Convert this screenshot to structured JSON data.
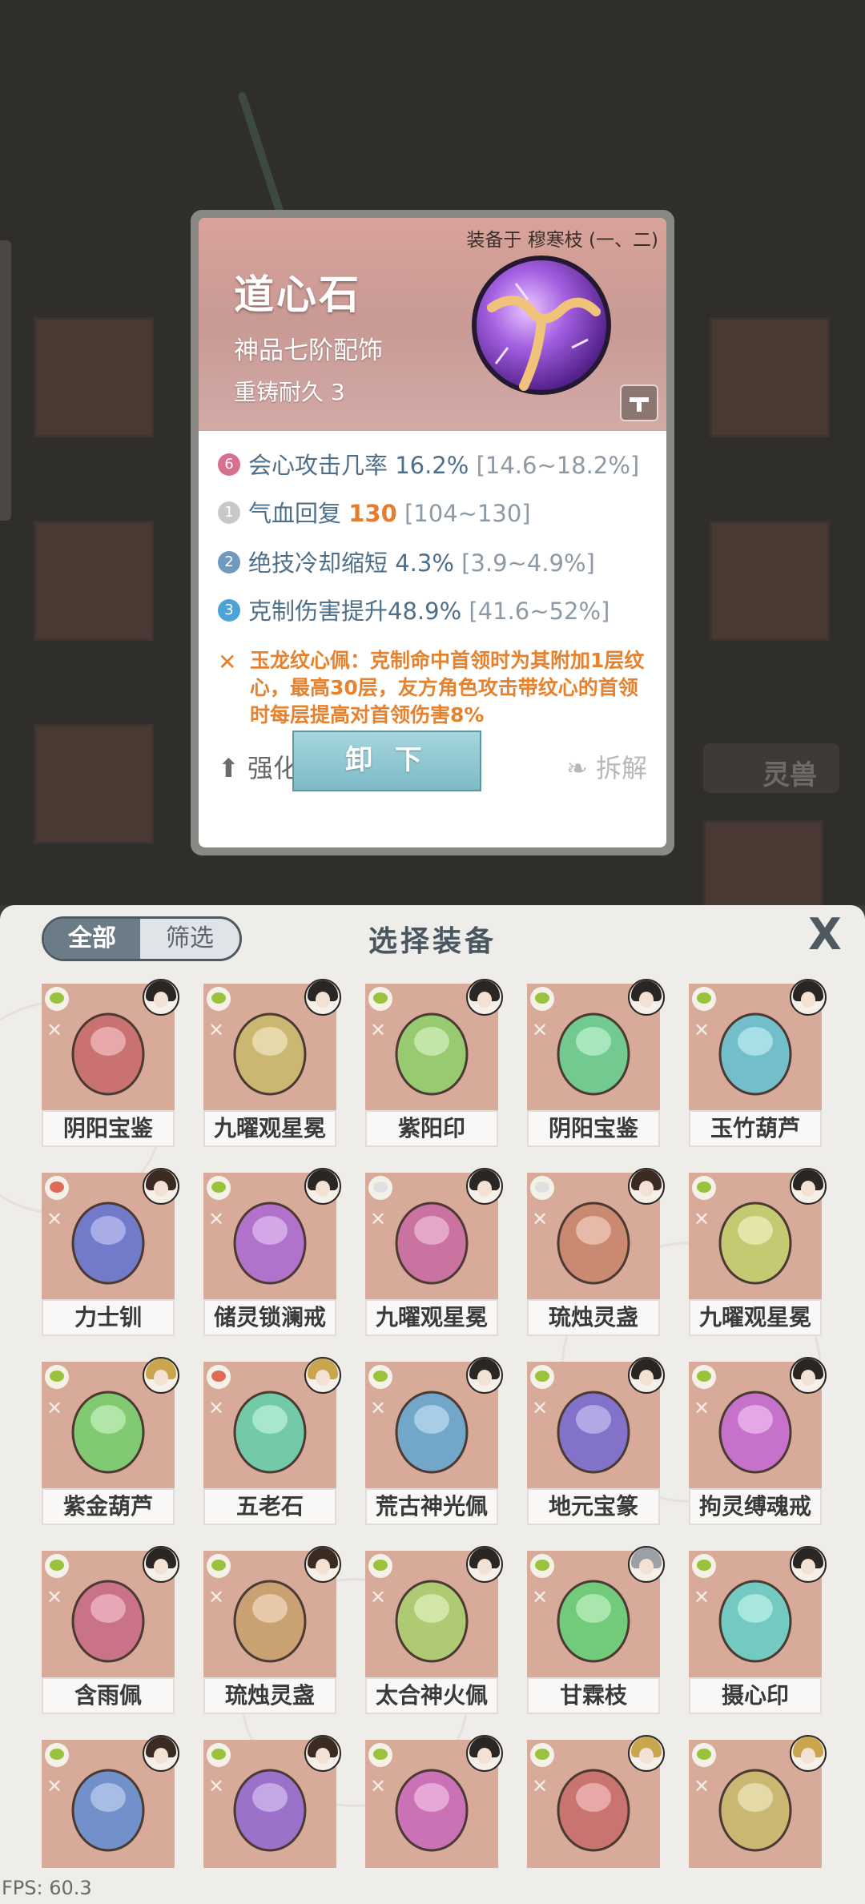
{
  "background": {
    "side_tab_label": "灵兽"
  },
  "detail": {
    "equipped_on": "装备于 穆寒枝 (一、二)",
    "name": "道心石",
    "grade": "神品七阶配饰",
    "durability": "重铸耐久 3",
    "stats": [
      {
        "badge": "6",
        "badge_color": "#d76f8e",
        "label": "会心攻击几率 ",
        "value": "16.2%",
        "range": " [14.6~18.2%]",
        "highlight": false
      },
      {
        "badge": "1",
        "badge_color": "#c8c8c8",
        "label": "气血回复 ",
        "value": "130",
        "range": " [104~130]",
        "highlight": true
      },
      {
        "badge": "2",
        "badge_color": "#6e9ac0",
        "label": "绝技冷却缩短 ",
        "value": "4.3%",
        "range": " [3.9~4.9%]",
        "highlight": false
      },
      {
        "badge": "3",
        "badge_color": "#4ea3d6",
        "label": "克制伤害提升",
        "value": "48.9%",
        "range": " [41.6~52%]",
        "highlight": false
      }
    ],
    "special": "玉龙纹心佩：克制命中首领时为其附加1层纹心，最高30层，友方角色攻击带纹心的首领时每层提高对首领伤害8%",
    "special_icon": "pattern-icon",
    "unequip_label": "卸 下",
    "enhance_label": "强化",
    "dismantle_label": "拆解"
  },
  "panel": {
    "filter_all": "全部",
    "filter_screen": "筛选",
    "title": "选择装备",
    "close": "X"
  },
  "items": [
    {
      "name": "阴阳宝鉴",
      "elem": "#9bc23c",
      "avatar_hair": "#2a2624"
    },
    {
      "name": "九曜观星冕",
      "elem": "#9bc23c",
      "avatar_hair": "#2a2624"
    },
    {
      "name": "紫阳印",
      "elem": "#9bc23c",
      "avatar_hair": "#2a2624"
    },
    {
      "name": "阴阳宝鉴",
      "elem": "#9bc23c",
      "avatar_hair": "#2a2624"
    },
    {
      "name": "玉竹葫芦",
      "elem": "#9bc23c",
      "avatar_hair": "#2a2624"
    },
    {
      "name": "力士钏",
      "elem": "#e06a5a",
      "avatar_hair": "#3a2a22"
    },
    {
      "name": "储灵锁澜戒",
      "elem": "#9bc23c",
      "avatar_hair": "#2a2624"
    },
    {
      "name": "九曜观星冕",
      "elem": "#e0e0e0",
      "avatar_hair": "#2a2624"
    },
    {
      "name": "琉烛灵盏",
      "elem": "#e0e0e0",
      "avatar_hair": "#3a2a22"
    },
    {
      "name": "九曜观星冕",
      "elem": "#9bc23c",
      "avatar_hair": "#2a2624"
    },
    {
      "name": "紫金葫芦",
      "elem": "#9bc23c",
      "avatar_hair": "#c9a64e"
    },
    {
      "name": "五老石",
      "elem": "#e06a5a",
      "avatar_hair": "#c9a64e"
    },
    {
      "name": "荒古神光佩",
      "elem": "#9bc23c",
      "avatar_hair": "#2a2624"
    },
    {
      "name": "地元宝篆",
      "elem": "#9bc23c",
      "avatar_hair": "#2a2624"
    },
    {
      "name": "拘灵缚魂戒",
      "elem": "#9bc23c",
      "avatar_hair": "#2a2624"
    },
    {
      "name": "含雨佩",
      "elem": "#9bc23c",
      "avatar_hair": "#2a2624"
    },
    {
      "name": "琉烛灵盏",
      "elem": "#9bc23c",
      "avatar_hair": "#3a2a22"
    },
    {
      "name": "太合神火佩",
      "elem": "#9bc23c",
      "avatar_hair": "#2a2624"
    },
    {
      "name": "甘霖枝",
      "elem": "#9bc23c",
      "avatar_hair": "#9aa0a6"
    },
    {
      "name": "摄心印",
      "elem": "#9bc23c",
      "avatar_hair": "#2a2624"
    },
    {
      "name": "",
      "elem": "#9bc23c",
      "avatar_hair": "#3a2a22"
    },
    {
      "name": "",
      "elem": "#9bc23c",
      "avatar_hair": "#3a2a22"
    },
    {
      "name": "",
      "elem": "#9bc23c",
      "avatar_hair": "#2a2624"
    },
    {
      "name": "",
      "elem": "#9bc23c",
      "avatar_hair": "#c9a64e"
    },
    {
      "name": "",
      "elem": "#9bc23c",
      "avatar_hair": "#c9a64e"
    }
  ],
  "fps": "FPS: 60.3"
}
